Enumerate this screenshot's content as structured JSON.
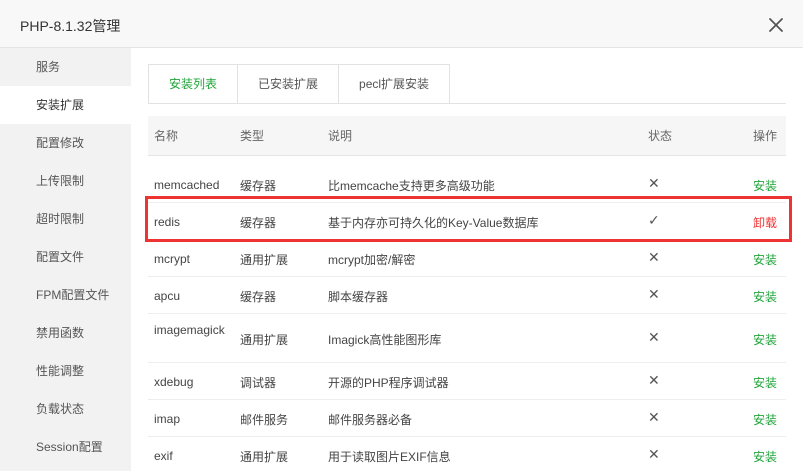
{
  "window": {
    "title": "PHP-8.1.32管理"
  },
  "sidebar": {
    "items": [
      {
        "label": "服务"
      },
      {
        "label": "安装扩展",
        "active": true
      },
      {
        "label": "配置修改"
      },
      {
        "label": "上传限制"
      },
      {
        "label": "超时限制"
      },
      {
        "label": "配置文件"
      },
      {
        "label": "FPM配置文件"
      },
      {
        "label": "禁用函数"
      },
      {
        "label": "性能调整"
      },
      {
        "label": "负载状态"
      },
      {
        "label": "Session配置"
      }
    ]
  },
  "tabs": [
    {
      "label": "安装列表",
      "active": true
    },
    {
      "label": "已安装扩展"
    },
    {
      "label": "pecl扩展安装"
    }
  ],
  "table": {
    "headers": {
      "name": "名称",
      "type": "类型",
      "desc": "说明",
      "status": "状态",
      "op": "操作"
    },
    "rows": [
      {
        "name": "memcached",
        "type": "缓存器",
        "desc": "比memcache支持更多高级功能",
        "status": "✕",
        "op": "安装"
      },
      {
        "name": "redis",
        "type": "缓存器",
        "desc": "基于内存亦可持久化的Key-Value数据库",
        "status": "✓",
        "op": "卸载"
      },
      {
        "name": "mcrypt",
        "type": "通用扩展",
        "desc": "mcrypt加密/解密",
        "status": "✕",
        "op": "安装"
      },
      {
        "name": "apcu",
        "type": "缓存器",
        "desc": "脚本缓存器",
        "status": "✕",
        "op": "安装"
      },
      {
        "name": "imagemagick",
        "type": "通用扩展",
        "desc": "Imagick高性能图形库",
        "status": "✕",
        "op": "安装"
      },
      {
        "name": "xdebug",
        "type": "调试器",
        "desc": "开源的PHP程序调试器",
        "status": "✕",
        "op": "安装"
      },
      {
        "name": "imap",
        "type": "邮件服务",
        "desc": "邮件服务器必备",
        "status": "✕",
        "op": "安装"
      },
      {
        "name": "exif",
        "type": "通用扩展",
        "desc": "用于读取图片EXIF信息",
        "status": "✕",
        "op": "安装"
      }
    ]
  },
  "colors": {
    "accent": "#20a53a",
    "danger": "#ee3333"
  }
}
